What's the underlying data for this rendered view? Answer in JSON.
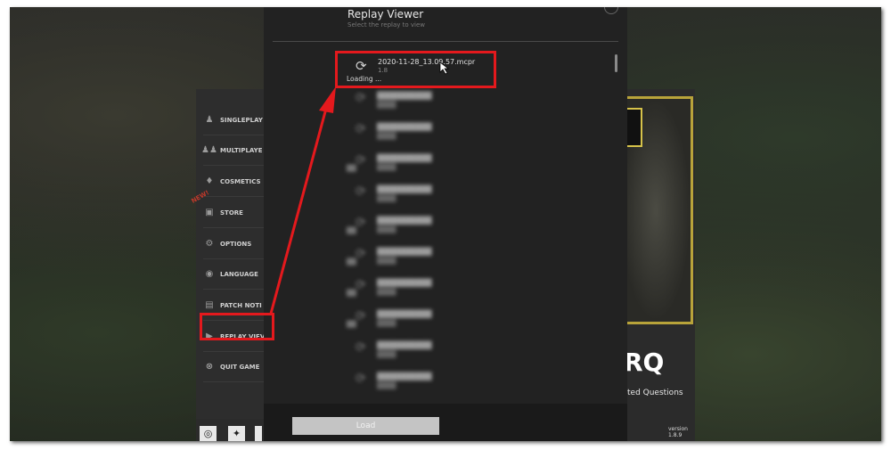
{
  "sidebar": {
    "items": [
      {
        "label": "SINGLEPLAY",
        "icon": "person-icon"
      },
      {
        "label": "MULTIPLAYE",
        "icon": "group-icon"
      },
      {
        "label": "COSMETICS",
        "icon": "bell-icon"
      },
      {
        "label": "STORE",
        "icon": "cart-icon"
      },
      {
        "label": "OPTIONS",
        "icon": "gear-icon"
      },
      {
        "label": "LANGUAGE",
        "icon": "globe-icon"
      },
      {
        "label": "PATCH NOTI",
        "icon": "notes-icon"
      },
      {
        "label": "REPLAY VIEV",
        "icon": "youtube-icon"
      },
      {
        "label": "QUIT GAME",
        "icon": "close-circle-icon"
      }
    ],
    "new_tag": "NEW!"
  },
  "modal": {
    "title": "Replay Viewer",
    "subtitle": "Select the replay to view",
    "first_entry": {
      "name": "2020-11-28_13.09.57.mcpr",
      "version": "1.8",
      "status": "Loading ..."
    },
    "load_button": "Load"
  },
  "faq": {
    "big": "RQ",
    "sub": "ted Questions"
  },
  "version": "version 1.8.9",
  "social": [
    "discord-icon",
    "twitter-icon",
    "more-icon"
  ],
  "colors": {
    "highlight": "#e4191d",
    "accent_gold": "#b8a33a"
  }
}
